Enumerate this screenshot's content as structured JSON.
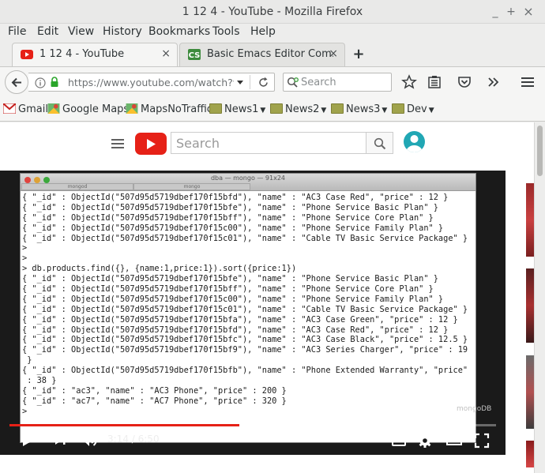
{
  "window": {
    "title": "1 12 4 - YouTube - Mozilla Firefox",
    "min": "_",
    "max": "+",
    "close": "×"
  },
  "menu": [
    "File",
    "Edit",
    "View",
    "History",
    "Bookmarks",
    "Tools",
    "Help"
  ],
  "tabs": [
    {
      "label": "1 12 4 - YouTube",
      "close": "×"
    },
    {
      "label": "Basic Emacs Editor Com…",
      "close": "×"
    }
  ],
  "newtab": "+",
  "url": "https://www.youtube.com/watch?v=Ez",
  "search_placeholder": "Search",
  "bookmarks": [
    {
      "label": "Gmail"
    },
    {
      "label": "Google Maps"
    },
    {
      "label": "MapsNoTraffic"
    },
    {
      "label": "News1"
    },
    {
      "label": "News2"
    },
    {
      "label": "News3"
    },
    {
      "label": "Dev"
    }
  ],
  "youtube": {
    "search_placeholder": "Search",
    "terminal": {
      "title": "dba — mongo — 91x24",
      "tab1": "mongod",
      "tab2": "mongo",
      "lines": [
        "{ \"_id\" : ObjectId(\"507d95d5719dbef170f15bfd\"), \"name\" : \"AC3 Case Red\", \"price\" : 12 }",
        "{ \"_id\" : ObjectId(\"507d95d5719dbef170f15bfe\"), \"name\" : \"Phone Service Basic Plan\" }",
        "{ \"_id\" : ObjectId(\"507d95d5719dbef170f15bff\"), \"name\" : \"Phone Service Core Plan\" }",
        "{ \"_id\" : ObjectId(\"507d95d5719dbef170f15c00\"), \"name\" : \"Phone Service Family Plan\" }",
        "{ \"_id\" : ObjectId(\"507d95d5719dbef170f15c01\"), \"name\" : \"Cable TV Basic Service Package\" }",
        ">",
        ">",
        "> db.products.find({}, {name:1,price:1}).sort({price:1})",
        "{ \"_id\" : ObjectId(\"507d95d5719dbef170f15bfe\"), \"name\" : \"Phone Service Basic Plan\" }",
        "{ \"_id\" : ObjectId(\"507d95d5719dbef170f15bff\"), \"name\" : \"Phone Service Core Plan\" }",
        "{ \"_id\" : ObjectId(\"507d95d5719dbef170f15c00\"), \"name\" : \"Phone Service Family Plan\" }",
        "{ \"_id\" : ObjectId(\"507d95d5719dbef170f15c01\"), \"name\" : \"Cable TV Basic Service Package\" }",
        "{ \"_id\" : ObjectId(\"507d95d5719dbef170f15bfa\"), \"name\" : \"AC3 Case Green\", \"price\" : 12 }",
        "{ \"_id\" : ObjectId(\"507d95d5719dbef170f15bfd\"), \"name\" : \"AC3 Case Red\", \"price\" : 12 }",
        "{ \"_id\" : ObjectId(\"507d95d5719dbef170f15bfc\"), \"name\" : \"AC3 Case Black\", \"price\" : 12.5 }",
        "{ \"_id\" : ObjectId(\"507d95d5719dbef170f15bf9\"), \"name\" : \"AC3 Series Charger\", \"price\" : 19",
        " }",
        "{ \"_id\" : ObjectId(\"507d95d5719dbef170f15bfb\"), \"name\" : \"Phone Extended Warranty\", \"price\"",
        " : 38 }",
        "{ \"_id\" : \"ac3\", \"name\" : \"AC3 Phone\", \"price\" : 200 }",
        "{ \"_id\" : \"ac7\", \"name\" : \"AC7 Phone\", \"price\" : 320 }",
        ">"
      ]
    },
    "watermark": "mongoDB",
    "time_current": "3:14",
    "time_total": "6:50",
    "time_separator": " / ",
    "progress_fraction": 0.473,
    "cc_label": "CC"
  },
  "colors": {
    "youtube_red": "#e62117",
    "folder": "#a0a34c"
  }
}
